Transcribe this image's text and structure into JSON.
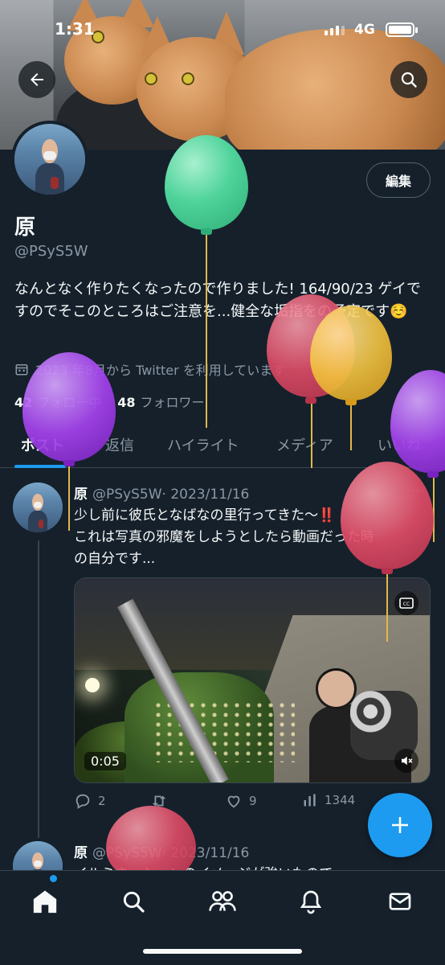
{
  "status_bar": {
    "time": "1:31",
    "network": "4G"
  },
  "profile": {
    "name": "原",
    "handle": "@PSyS5W",
    "edit_label": "編集",
    "bio": "なんとなく作りたくなったので作りました! 164/90/23 ゲイですのでそこのところはご注意を...健全な垢指をの予定です☺️",
    "joined": "2023 年8月から Twitter を利用しています",
    "following_count": "42",
    "following_label": "フォロー中",
    "followers_count": "48",
    "followers_label": "フォロワー"
  },
  "tabs": [
    {
      "label": "ポスト",
      "active": true
    },
    {
      "label": "返信"
    },
    {
      "label": "ハイライト"
    },
    {
      "label": "メディア"
    },
    {
      "label": "いいね"
    }
  ],
  "tweets": [
    {
      "name": "原",
      "handle": "@PSyS5W",
      "date": "· 2023/11/16",
      "text_line1": "少し前に彼氏となばなの里行ってきた〜‼️",
      "text_line2": "これは写真の邪魔をしようとしたら動画だった時",
      "text_line3": "の自分です...",
      "video_time": "0:05",
      "stats": {
        "replies": "2",
        "likes": "9",
        "views": "1344"
      }
    },
    {
      "name": "原",
      "handle": "@PSyS5W",
      "date": "· 2023/11/16",
      "text_line1": "イルミネーションのイメージが強いものでー..."
    }
  ],
  "icons": {
    "back": "back-arrow-icon",
    "search": "search-icon",
    "calendar": "calendar-icon",
    "reply": "reply-icon",
    "retweet": "retweet-icon",
    "like": "heart-icon",
    "views": "views-icon",
    "compose": "plus-icon",
    "home": "home-icon",
    "explore": "search-icon",
    "communities": "communities-icon",
    "notifications": "bell-icon",
    "messages": "mail-icon"
  },
  "colors": {
    "accent": "#1d9bf0",
    "background": "#15202b",
    "secondary_text": "#8b98a5"
  }
}
